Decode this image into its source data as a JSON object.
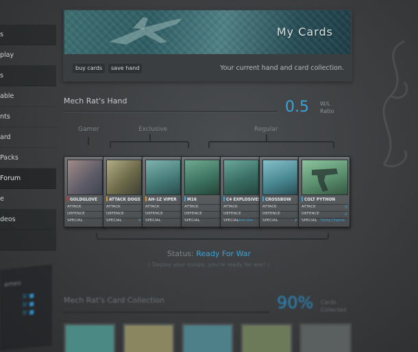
{
  "sidebar": {
    "items": [
      {
        "label": "s"
      },
      {
        "label": "play"
      },
      {
        "label": "s"
      },
      {
        "label": "able"
      },
      {
        "label": "nts"
      },
      {
        "label": "ard"
      },
      {
        "label": "Packs"
      },
      {
        "label": "Forum"
      },
      {
        "label": "e"
      },
      {
        "label": "deos"
      }
    ],
    "block_label": "ames",
    "block_stats": [
      "3/ ■",
      "3/ ■",
      "3/ ■"
    ]
  },
  "header": {
    "title": "My Cards",
    "buttons": [
      "buy cards",
      "save hand"
    ],
    "description": "Your current hand and card collection."
  },
  "hand": {
    "title": "Mech Rat's Hand",
    "ratio_value": "0.5",
    "ratio_label_line1": "W/L",
    "ratio_label_line2": "Ratio",
    "categories": [
      "Gamer",
      "Exclusive",
      "Regular"
    ],
    "stat_labels": {
      "attack": "ATTACK",
      "defence": "DEFENCE",
      "special": "SPECIAL"
    },
    "cards": [
      {
        "name": "GOLDGLOVE",
        "flag_color": "#c23a32",
        "art": "#7a6d73",
        "attack": "",
        "defence": "",
        "special": ""
      },
      {
        "name": "ATTACK DOGS",
        "flag_color": "#d99a2b",
        "art": "#8e8a5a",
        "attack": "",
        "defence": "",
        "special": "P"
      },
      {
        "name": "AH-1Z VIPER",
        "flag_color": "#d99a2b",
        "art": "#4f8a86",
        "attack": "",
        "defence": "",
        "special": ""
      },
      {
        "name": "M16",
        "flag_color": "#3aa4d8",
        "art": "#3f7c6a",
        "attack": "",
        "defence": "",
        "special": ""
      },
      {
        "name": "C4 EXPLOSIVES",
        "flag_color": "#3aa4d8",
        "art": "#3d7468",
        "attack": "",
        "defence": "",
        "special": "Anti-Gro"
      },
      {
        "name": "CROSSBOW",
        "flag_color": "#3aa4d8",
        "art": "#4b8a94",
        "attack": "",
        "defence": "",
        "special": "P"
      },
      {
        "name": "COLT PYTHON",
        "flag_color": "#3aa4d8",
        "art": "#5b8f6e",
        "attack": "5",
        "defence": "2",
        "special": "Dying Chance"
      }
    ]
  },
  "status": {
    "label": "Status:",
    "value": "Ready For War",
    "subtext": "( Deploy your troops, you're ready for war! )"
  },
  "collection": {
    "title": "Mech Rat's Card Collection",
    "percent": "90%",
    "label_line1": "Cards",
    "label_line2": "Collected",
    "thumb_colors": [
      "#4b8a84",
      "#8a8660",
      "#4d8088",
      "#6d7a5a",
      "#5a6060"
    ]
  }
}
